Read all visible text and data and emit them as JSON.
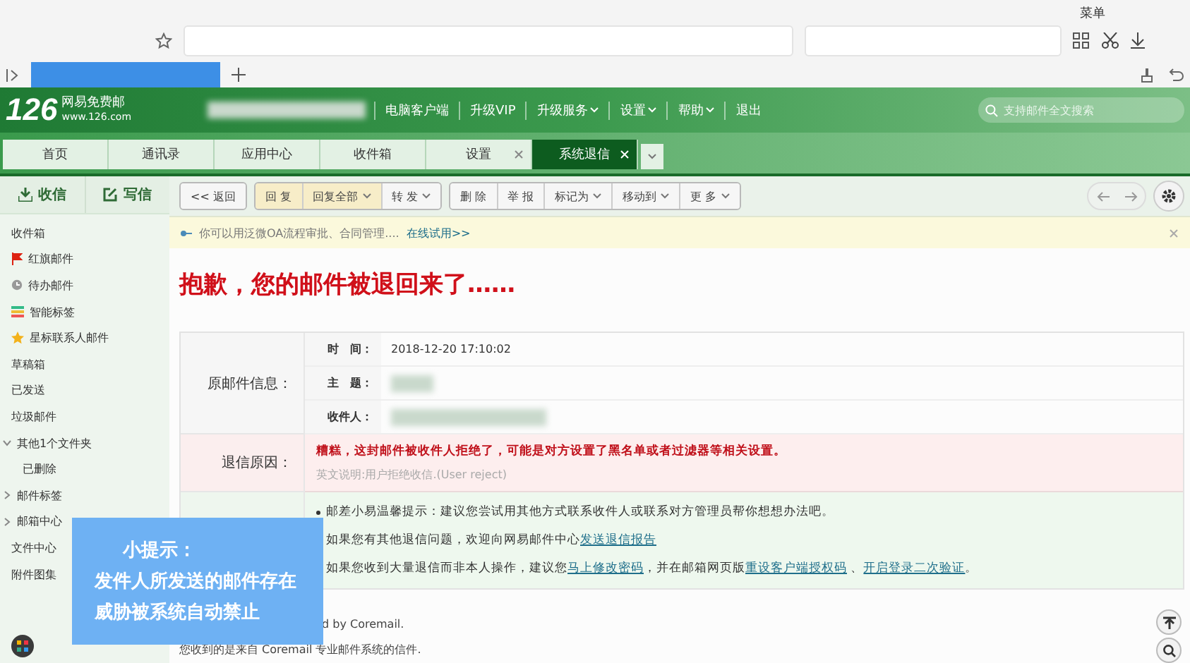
{
  "browser": {
    "menu_label": "菜单"
  },
  "app": {
    "logo": "126",
    "logo_name": "网易免费邮",
    "logo_url": "www.126.com",
    "account_redacted": true,
    "nav": [
      {
        "label": "电脑客户端",
        "dropdown": false
      },
      {
        "label": "升级VIP",
        "dropdown": false
      },
      {
        "label": "升级服务",
        "dropdown": true
      },
      {
        "label": "设置",
        "dropdown": true
      },
      {
        "label": "帮助",
        "dropdown": true
      },
      {
        "label": "退出",
        "dropdown": false
      }
    ],
    "search": {
      "placeholder": "支持邮件全文搜索"
    }
  },
  "tabs": [
    {
      "label": "首页",
      "selected": false,
      "closable": false
    },
    {
      "label": "通讯录",
      "selected": false,
      "closable": false
    },
    {
      "label": "应用中心",
      "selected": false,
      "closable": false
    },
    {
      "label": "收件箱",
      "selected": false,
      "closable": false
    },
    {
      "label": "设置",
      "selected": false,
      "closable": true
    },
    {
      "label": "系统退信",
      "selected": true,
      "closable": true
    }
  ],
  "sidebar": {
    "receive": "收信",
    "compose": "写信",
    "items": [
      {
        "label": "收件箱",
        "kind": "folder"
      },
      {
        "label": "红旗邮件",
        "kind": "flagged"
      },
      {
        "label": "待办邮件",
        "kind": "todo"
      },
      {
        "label": "智能标签",
        "kind": "tags"
      },
      {
        "label": "星标联系人邮件",
        "kind": "starred"
      },
      {
        "label": "草稿箱",
        "kind": "folder"
      },
      {
        "label": "已发送",
        "kind": "folder"
      },
      {
        "label": "垃圾邮件",
        "kind": "folder"
      },
      {
        "label": "其他1个文件夹",
        "kind": "group",
        "expanded": true,
        "children": [
          {
            "label": "已删除"
          }
        ]
      },
      {
        "label": "邮件标签",
        "kind": "group",
        "expanded": false
      },
      {
        "label": "邮箱中心",
        "kind": "group",
        "expanded": false
      },
      {
        "label": "文件中心",
        "kind": "folder"
      },
      {
        "label": "附件图集",
        "kind": "folder"
      }
    ]
  },
  "toolbar": [
    [
      {
        "label": "<< 返回",
        "kind": "normal",
        "dropdown": false
      }
    ],
    [
      {
        "label": "回 复",
        "kind": "primary",
        "dropdown": false
      },
      {
        "label": "回复全部",
        "kind": "primary",
        "dropdown": true
      },
      {
        "label": "转 发",
        "kind": "normal",
        "dropdown": true
      }
    ],
    [
      {
        "label": "删 除",
        "kind": "normal",
        "dropdown": false
      },
      {
        "label": "举 报",
        "kind": "normal",
        "dropdown": false
      },
      {
        "label": "标记为",
        "kind": "normal",
        "dropdown": true
      },
      {
        "label": "移动到",
        "kind": "normal",
        "dropdown": true
      },
      {
        "label": "更 多",
        "kind": "normal",
        "dropdown": true
      }
    ]
  ],
  "notice": {
    "text": "你可以用泛微OA流程审批、合同管理....",
    "link": "在线试用>>"
  },
  "heading": "抱歉，您的邮件被退回来了……",
  "original": {
    "label": "原邮件信息：",
    "fields": [
      {
        "label": "时　间：",
        "value": "2018-12-20 17:10:02",
        "redacted": false
      },
      {
        "label": "主　题：",
        "redacted": true
      },
      {
        "label": "收件人：",
        "redacted": true
      }
    ]
  },
  "reason": {
    "label": "退信原因：",
    "text": "糟糕，这封邮件被收件人拒绝了，可能是对方设置了黑名单或者过滤器等相关设置。",
    "detail": "英文说明:用户拒绝收信.(User reject)"
  },
  "suggestions": [
    [
      {
        "text": "邮差小易温馨提示：建议您尝试用其他方式联系收件人或联系对方管理员帮你想想办法吧。"
      }
    ],
    [
      {
        "text": "如果您有其他退信问题，欢迎向网易邮件中心"
      },
      {
        "link": "发送退信报告"
      }
    ],
    [
      {
        "text": "如果您收到大量退信而非本人操作，建议您"
      },
      {
        "link": "马上修改密码"
      },
      {
        "text": "，并在邮箱网页版"
      },
      {
        "link": "重设客户端授权码"
      },
      {
        "text": " 、"
      },
      {
        "link": "开启登录二次验证"
      },
      {
        "text": "。"
      }
    ]
  ],
  "footer": [
    "d by Coremail.",
    "您收到的是来自 Coremail 专业邮件系统的信件."
  ],
  "tip": {
    "title": "小提示：",
    "lines": [
      "发件人所发送的邮件存在",
      "威胁被系统自动禁止"
    ]
  }
}
